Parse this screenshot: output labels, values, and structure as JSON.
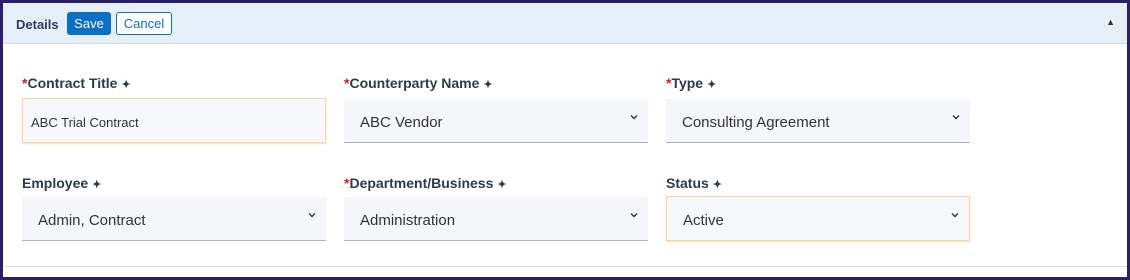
{
  "header": {
    "title": "Details",
    "save_label": "Save",
    "cancel_label": "Cancel",
    "collapse_icon": "triangle-up-icon"
  },
  "fields": {
    "contract_title": {
      "label": "Contract Title",
      "required_mark": "*",
      "value": "ABC Trial Contract",
      "control": "text"
    },
    "counterparty_name": {
      "label": "Counterparty Name",
      "required_mark": "*",
      "value": "ABC Vendor",
      "control": "select"
    },
    "type": {
      "label": "Type",
      "required_mark": "*",
      "value": "Consulting Agreement",
      "control": "select"
    },
    "employee": {
      "label": "Employee",
      "required_mark": "",
      "value": "Admin, Contract",
      "control": "select"
    },
    "department_business": {
      "label": "Department/Business",
      "required_mark": "*",
      "value": "Administration",
      "control": "select"
    },
    "status": {
      "label": "Status",
      "required_mark": "",
      "value": "Active",
      "control": "select"
    }
  },
  "label_icon": "sparkle-icon",
  "colors": {
    "primary": "#0b6fc6",
    "required": "#d42020",
    "header_bg": "#e6eef8",
    "frame": "#2a1f66"
  }
}
